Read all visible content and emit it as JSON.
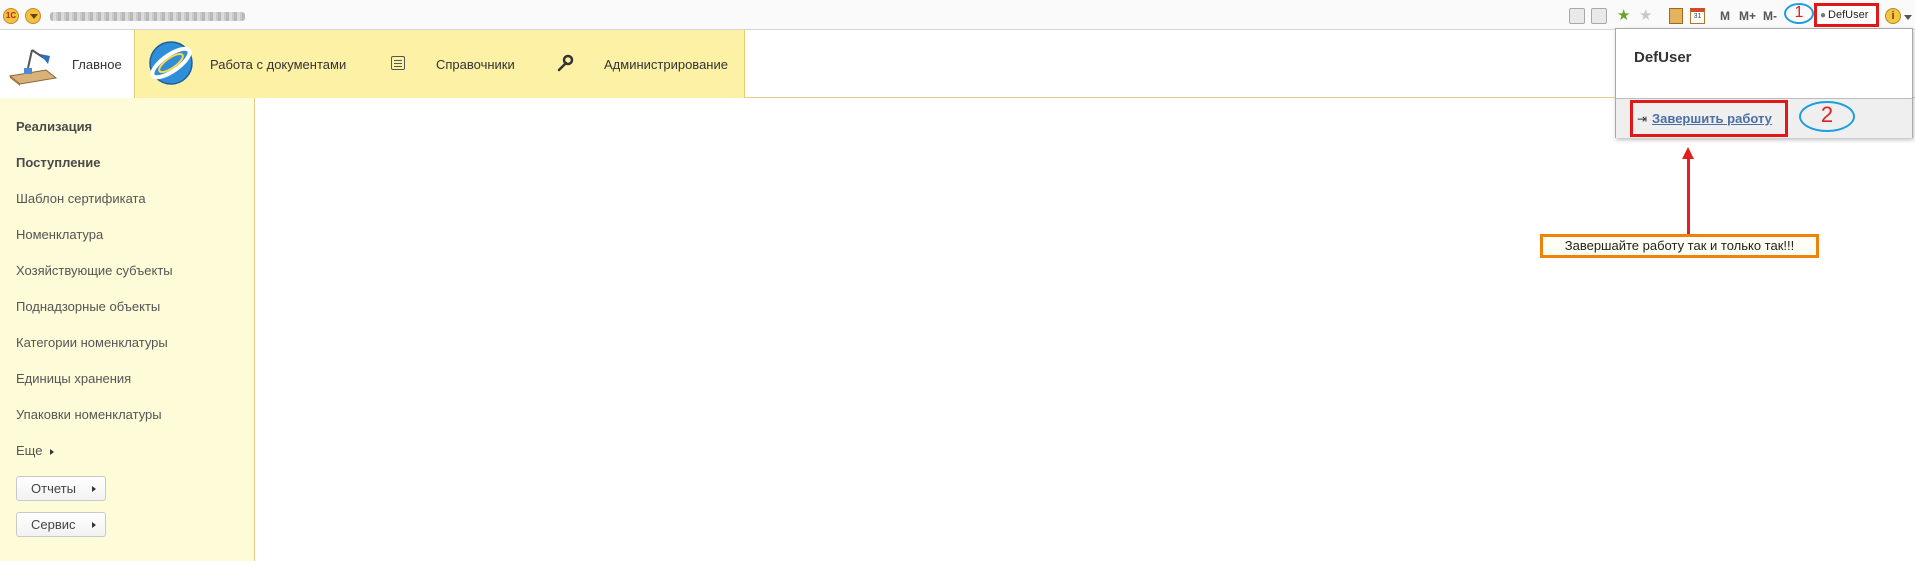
{
  "titlebar": {
    "app_logo": "1C",
    "user_label": "DefUser",
    "memory_buttons": [
      "M",
      "M+",
      "M-"
    ],
    "info_label": "i",
    "annotation_marker": "1"
  },
  "sections": {
    "home": "Главное",
    "documents": "Работа с документами",
    "references": "Справочники",
    "admin": "Администрирование"
  },
  "nav": {
    "items": [
      {
        "label": "Реализация",
        "bold": true
      },
      {
        "label": "Поступление",
        "bold": true
      },
      {
        "label": "Шаблон сертификата",
        "bold": false
      },
      {
        "label": "Номенклатура",
        "bold": false
      },
      {
        "label": "Хозяйствующие субъекты",
        "bold": false
      },
      {
        "label": "Поднадзорные объекты",
        "bold": false
      },
      {
        "label": "Категории номенклатуры",
        "bold": false
      },
      {
        "label": "Единицы хранения",
        "bold": false
      },
      {
        "label": "Упаковки номенклатуры",
        "bold": false
      }
    ],
    "more": "Еще",
    "reports": "Отчеты",
    "service": "Сервис"
  },
  "popup": {
    "user_name": "DefUser",
    "logout": "Завершить работу",
    "annotation_marker": "2"
  },
  "annotation": {
    "note": "Завершайте работу так и только  так!!!"
  },
  "colors": {
    "section_band": "#fdf1a6",
    "nav_background": "#fefbd8",
    "annotation_red": "#e01818",
    "annotation_blue": "#1e9ee0",
    "annotation_orange": "#f0820a",
    "link": "#4a6fa5"
  }
}
